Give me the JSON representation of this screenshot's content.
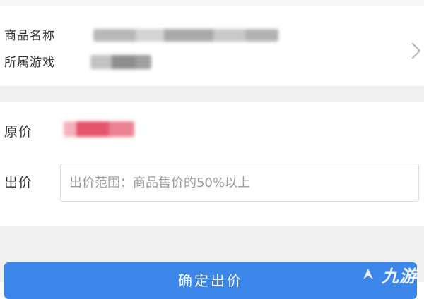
{
  "product": {
    "name_label": "商品名称",
    "game_label": "所属游戏",
    "chevron_icon": "chevron-right-icon"
  },
  "price": {
    "original_label": "原价",
    "bid_label": "出价",
    "bid_placeholder": "出价范围：商品售价的50%以上",
    "accent_color": "#e5546a"
  },
  "footer": {
    "confirm_label": "确定出价",
    "button_color": "#3b86e8",
    "watermark": "九游"
  }
}
